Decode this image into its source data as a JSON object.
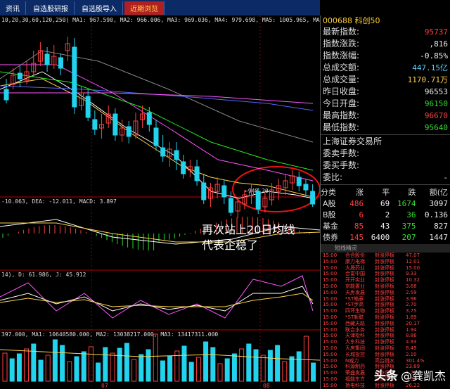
{
  "tabs": [
    "资讯",
    "自选股研报",
    "自选股导入",
    "近期浏览"
  ],
  "ma_line": "10,20,30,60,120,250)  MA1: 967.590, MA2: 966.006, MA3: 969.036, MA4: 979.698, MA5: 1005.965, MA6: 1007.000",
  "macd_line": "-10.063, DEA: -12.011, MACD: 3.897",
  "kdj_line": "14), D: 61.986, J: 45.912",
  "vol_line": "397.000, MA1: 10640580.000, MA2: 13038217.000, MA3: 13417311.000",
  "low_label": "←948.20",
  "month_labels": [
    "07",
    "08"
  ],
  "annotation": {
    "line1": "再次站上20日均线",
    "line2": "代表企稳了"
  },
  "panel": {
    "title": "000688 科创50",
    "quotes": [
      {
        "label": "最新指数:",
        "value": "95737",
        "color": "red"
      },
      {
        "label": "指数涨跌:",
        "value": ",816",
        "color": "white"
      },
      {
        "label": "指数涨幅:",
        "value": "-0.85%",
        "color": "white"
      },
      {
        "label": "总成交额:",
        "value": "447.15亿",
        "color": "cyan"
      },
      {
        "label": "总成交量:",
        "value": "1170.71万",
        "color": "yellow"
      },
      {
        "label": "昨日收盘:",
        "value": "96553",
        "color": "white"
      },
      {
        "label": "今日开盘:",
        "value": "96150",
        "color": "green"
      },
      {
        "label": "最高指数:",
        "value": "96670",
        "color": "red"
      },
      {
        "label": "最低指数:",
        "value": "95640",
        "color": "green"
      }
    ],
    "exchange": "上海证券交易所",
    "orders": [
      {
        "label": "委卖手数:",
        "value": ""
      },
      {
        "label": "委买手数:",
        "value": ""
      },
      {
        "label": "委比:",
        "value": "-"
      }
    ],
    "market_headers": [
      "分类",
      "涨",
      "平",
      "跌",
      "额(亿"
    ],
    "market_rows": [
      {
        "name": "A股",
        "up": "486",
        "flat": "69",
        "down": "1674",
        "amt": "3097"
      },
      {
        "name": "B股",
        "up": "6",
        "flat": "2",
        "down": "36",
        "amt": "0.136"
      },
      {
        "name": "基金",
        "up": "85",
        "flat": "43",
        "down": "375",
        "amt": "827"
      },
      {
        "name": "债券",
        "up": "145",
        "flat": "6400",
        "down": "207",
        "amt": "1447"
      }
    ],
    "news_header": "短线精灵",
    "news": [
      {
        "t": "15:00",
        "n": "合合股份",
        "e": "封涨停板",
        "v": "47.07"
      },
      {
        "t": "15:00",
        "n": "康力电梯",
        "e": "封涨停板",
        "v": "12.01"
      },
      {
        "t": "15:00",
        "n": "大晟药业",
        "e": "封涨停板",
        "v": "15.00"
      },
      {
        "t": "15:00",
        "n": "合富中国",
        "e": "封涨停板",
        "v": "9.33"
      },
      {
        "t": "15:00",
        "n": "开开实业",
        "e": "封涨停板",
        "v": "10.32"
      },
      {
        "t": "15:00",
        "n": "京能置业",
        "e": "封涨停板",
        "v": "3.68"
      },
      {
        "t": "15:00",
        "n": "天房发展",
        "e": "封涨停板",
        "v": "2.59"
      },
      {
        "t": "15:00",
        "n": "*ST皓泰",
        "e": "封涨停板",
        "v": "3.96"
      },
      {
        "t": "15:00",
        "n": "*ST步高",
        "e": "封涨停板",
        "v": "2.70"
      },
      {
        "t": "15:00",
        "n": "四环生物",
        "e": "封涨停板",
        "v": "3.75"
      },
      {
        "t": "15:00",
        "n": "*ST新联",
        "e": "封涨停板",
        "v": "1.89"
      },
      {
        "t": "15:00",
        "n": "西藏天路",
        "e": "封涨停板",
        "v": "20.17"
      },
      {
        "t": "15:00",
        "n": "联合水务",
        "e": "封涨停板",
        "v": "1.94"
      },
      {
        "t": "15:00",
        "n": "天津松科",
        "e": "封涨停板",
        "v": "8.86"
      },
      {
        "t": "15:00",
        "n": "大东科技",
        "e": "封涨停板",
        "v": "4.93"
      },
      {
        "t": "15:00",
        "n": "天房集团",
        "e": "封涨停板",
        "v": "8.49"
      },
      {
        "t": "15:00",
        "n": "长城投控",
        "e": "封涨停板",
        "v": "2.10"
      },
      {
        "t": "15:00",
        "n": "N威力",
        "e": "高台跳水",
        "v": "301.4%"
      },
      {
        "t": "15:00",
        "n": "科源制药",
        "e": "封涨停板",
        "v": "23.89"
      },
      {
        "t": "15:00",
        "n": "荣盛发展",
        "e": "封涨停板",
        "v": "1.70"
      },
      {
        "t": "15:00",
        "n": "福能东方",
        "e": "封涨停板",
        "v": "4.89"
      },
      {
        "t": "15:00",
        "n": "扬电科技",
        "e": "封涨停板",
        "v": "26.22"
      }
    ]
  },
  "watermark": {
    "logo": "头条",
    "author": "@龚凯杰"
  },
  "colors": {
    "up": "#ff4040",
    "down": "#22d3ee",
    "ma1": "#ffffff",
    "ma2": "#ffd24a",
    "ma3": "#ff55ff",
    "ma4": "#22ee22",
    "ma5": "#888888",
    "ma6": "#5566ff"
  }
}
